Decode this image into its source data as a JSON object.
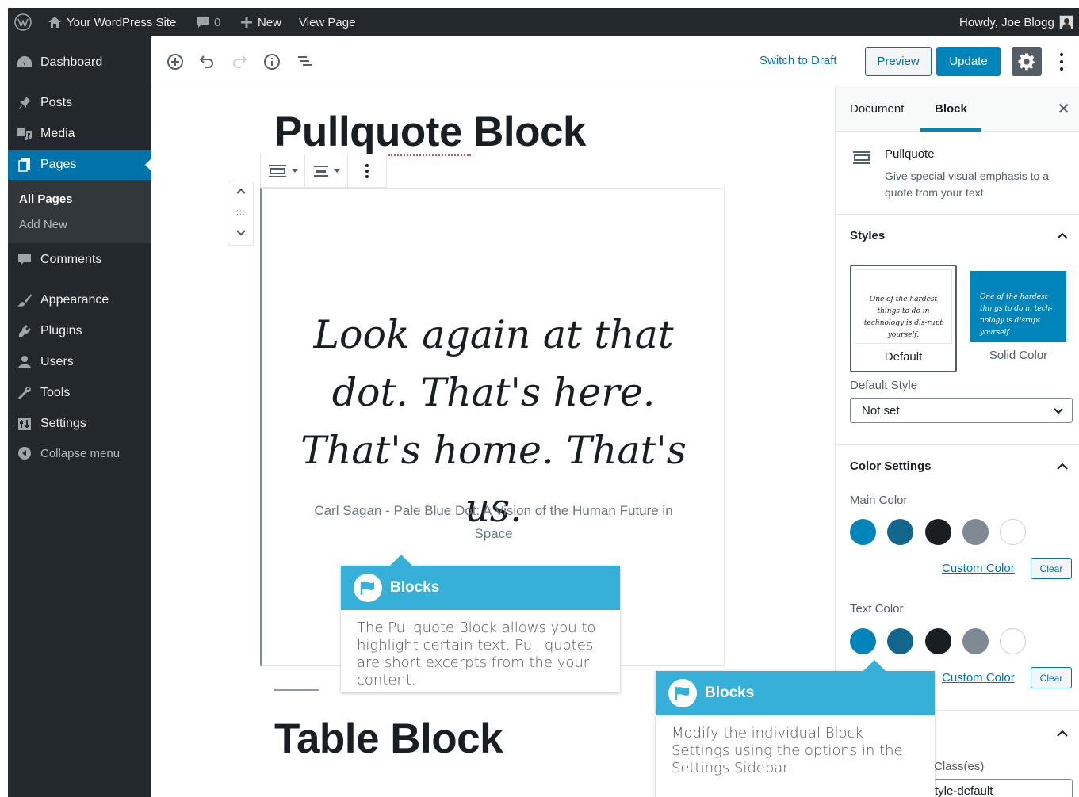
{
  "admin_bar": {
    "site_name": "Your WordPress Site",
    "comments_count": "0",
    "new_label": "New",
    "view_page_label": "View Page",
    "greeting": "Howdy, Joe Blogg"
  },
  "sidebar_menu": {
    "items": [
      {
        "label": "Dashboard",
        "icon": "dashboard-icon"
      },
      {
        "label": "Posts",
        "icon": "pin-icon"
      },
      {
        "label": "Media",
        "icon": "media-icon"
      },
      {
        "label": "Pages",
        "icon": "page-icon"
      },
      {
        "label": "Comments",
        "icon": "comment-icon"
      },
      {
        "label": "Appearance",
        "icon": "brush-icon"
      },
      {
        "label": "Plugins",
        "icon": "plug-icon"
      },
      {
        "label": "Users",
        "icon": "users-icon"
      },
      {
        "label": "Tools",
        "icon": "wrench-icon"
      },
      {
        "label": "Settings",
        "icon": "settings-icon"
      }
    ],
    "submenu": [
      "All Pages",
      "Add New"
    ],
    "collapse_label": "Collapse menu"
  },
  "header": {
    "switch_to_draft": "Switch to Draft",
    "preview": "Preview",
    "update": "Update"
  },
  "content": {
    "title": "Pullquote Block",
    "quote": "Look again at that dot. That's here. That's home. That's us.",
    "citation": "Carl Sagan - Pale Blue Dot: A Vision of the Human Future in Space",
    "next_heading": "Table Block"
  },
  "callouts": [
    {
      "title": "Blocks",
      "text": "The Pullquote Block allows you to highlight certain text. Pull quotes are short excerpts from the your content."
    },
    {
      "title": "Blocks",
      "text": "Modify the individual Block Settings using the options in the Settings Sidebar."
    }
  ],
  "settings_sidebar": {
    "tabs": [
      "Document",
      "Block"
    ],
    "active_tab": "Block",
    "block_name": "Pullquote",
    "block_description": "Give special visual emphasis to a quote from your text.",
    "styles": {
      "heading": "Styles",
      "options": [
        {
          "label": "Default",
          "preview": "One of the hardest things to do in technology is dis-rupt yourself."
        },
        {
          "label": "Solid Color",
          "preview": "One of the hardest things to do in tech-nology is disrupt yourself."
        }
      ],
      "default_style_label": "Default Style",
      "default_style_value": "Not set"
    },
    "color_settings": {
      "heading": "Color Settings",
      "main_color_label": "Main Color",
      "text_color_label": "Text Color",
      "palette": [
        "#0085ba",
        "#11668e",
        "#191e23",
        "#7e8993",
        "#ffffff"
      ],
      "custom_color": "Custom Color",
      "clear": "Clear"
    },
    "advanced": {
      "class_label": "Class(es)",
      "class_value": "tyle-default"
    }
  },
  "colors": {
    "admin_bg": "#23282d",
    "accent": "#0085ba",
    "callout": "#36b0d9"
  }
}
